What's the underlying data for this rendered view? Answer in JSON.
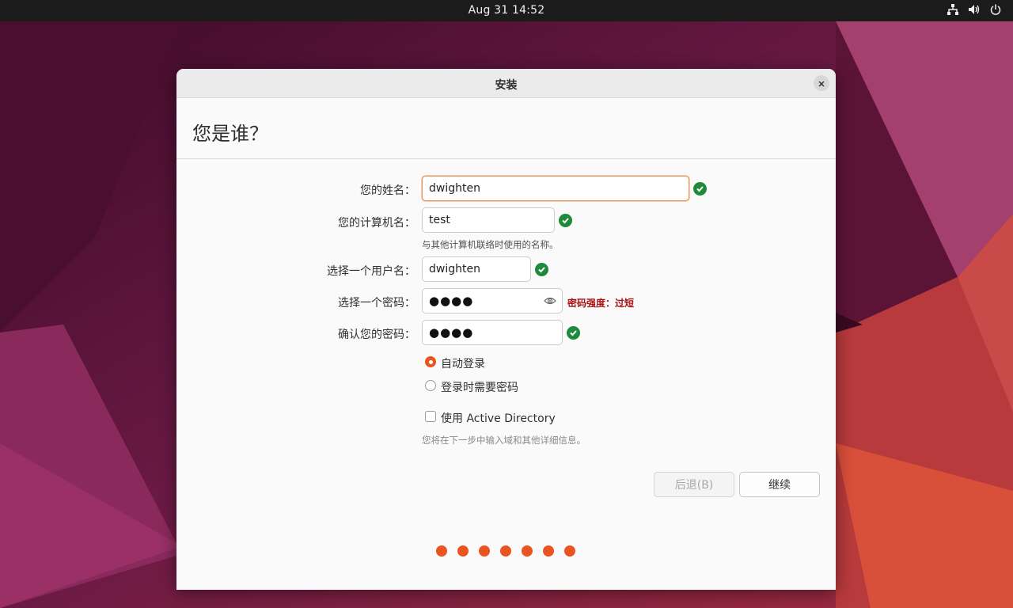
{
  "topbar": {
    "clock": "Aug 31  14:52",
    "icons": [
      "network-icon",
      "volume-icon",
      "power-icon"
    ]
  },
  "window": {
    "title": "安装",
    "heading": "您是谁？"
  },
  "form": {
    "name_label": "您的姓名：",
    "name_value": "dwighten",
    "computer_label": "您的计算机名：",
    "computer_value": "test",
    "computer_hint": "与其他计算机联络时使用的名称。",
    "username_label": "选择一个用户名：",
    "username_value": "dwighten",
    "password_label": "选择一个密码：",
    "password_value": "●●●●",
    "password_strength": "密码强度：过短",
    "confirm_label": "确认您的密码：",
    "confirm_value": "●●●●",
    "login_options": [
      {
        "label": "自动登录",
        "selected": true
      },
      {
        "label": "登录时需要密码",
        "selected": false
      }
    ],
    "ad_label": "使用 Active Directory",
    "ad_checked": false,
    "ad_hint": "您将在下一步中输入域和其他详细信息。"
  },
  "buttons": {
    "back": "后退(B)",
    "continue": "继续"
  },
  "progress": {
    "total_steps": 7
  },
  "colors": {
    "accent": "#e95420",
    "valid": "#1e8a3a",
    "error": "#a81212"
  }
}
